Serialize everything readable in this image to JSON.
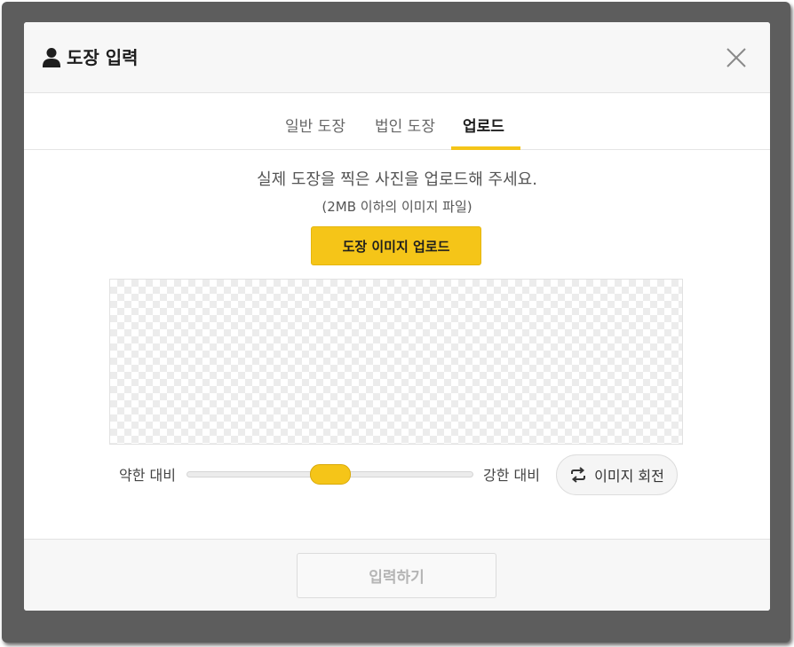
{
  "dialog": {
    "title": "도장 입력",
    "title_icon": "user-icon",
    "close_icon": "close-icon"
  },
  "tabs": [
    {
      "label": "일반 도장",
      "active": false
    },
    {
      "label": "법인 도장",
      "active": false
    },
    {
      "label": "업로드",
      "active": true
    }
  ],
  "upload": {
    "instruction": "실제 도장을 찍은 사진을 업로드해 주세요.",
    "sub_instruction": "(2MB 이하의 이미지 파일)",
    "button_label": "도장 이미지 업로드"
  },
  "contrast": {
    "low_label": "약한 대비",
    "high_label": "강한 대비",
    "value_fraction": 0.5
  },
  "rotate": {
    "label": "이미지 회전",
    "icon": "rotate-icon"
  },
  "footer": {
    "submit_label": "입력하기",
    "submit_enabled": false
  },
  "colors": {
    "accent": "#f5c518",
    "backdrop": "#5d5d5d",
    "header_bg": "#f7f7f7",
    "disabled_text": "#b5b5b5"
  }
}
